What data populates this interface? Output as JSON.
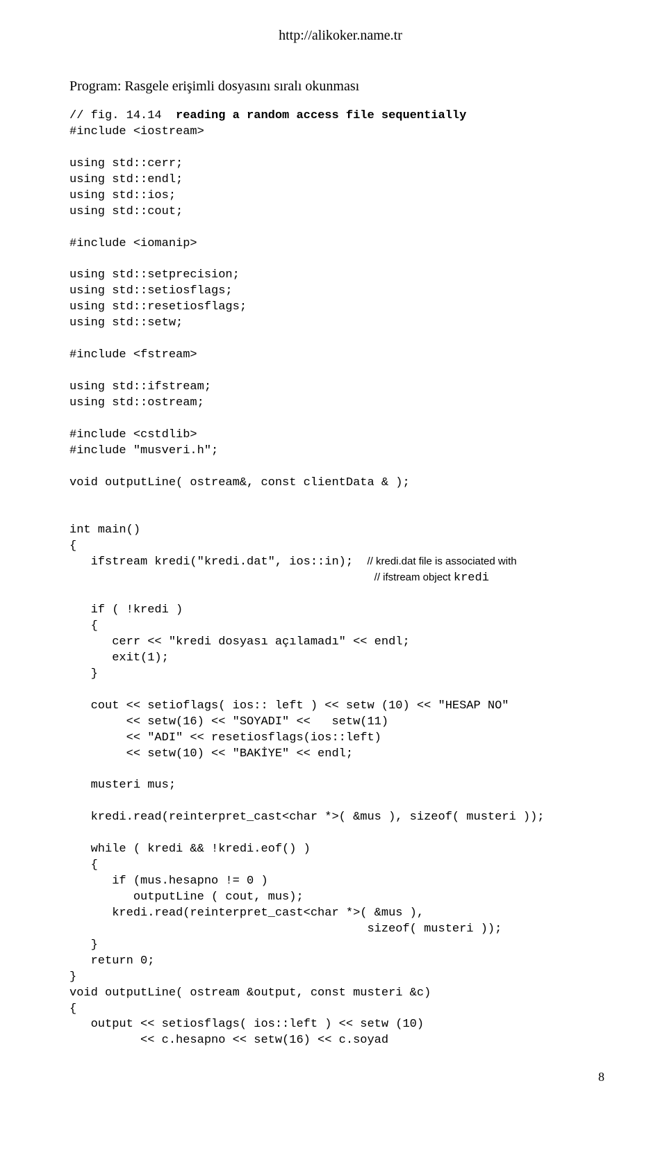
{
  "header_url": "http://alikoker.name.tr",
  "heading": "Program: Rasgele erişimli dosyasını  sıralı okunması",
  "code": {
    "l01a": "// fig. 14.14  ",
    "l01b": "reading a random access file sequentially",
    "l02": "#include <iostream>",
    "l03": "",
    "l04": "using std::cerr;",
    "l05": "using std::endl;",
    "l06": "using std::ios;",
    "l07": "using std::cout;",
    "l08": "",
    "l09": "#include <iomanip>",
    "l10": "",
    "l11": "using std::setprecision;",
    "l12": "using std::setiosflags;",
    "l13": "using std::resetiosflags;",
    "l14": "using std::setw;",
    "l15": "",
    "l16": "#include <fstream>",
    "l17": "",
    "l18": "using std::ifstream;",
    "l19": "using std::ostream;",
    "l20": "",
    "l21": "#include <cstdlib>",
    "l22": "#include \"musveri.h\";",
    "l23": "",
    "l24": "void outputLine( ostream&, const clientData & );",
    "l25": "",
    "l26": "",
    "l27": "int main()",
    "l28": "{",
    "l29a": "   ifstream kredi(\"kredi.dat\", ios::in);  ",
    "l29b": "// kredi.dat file is associated with",
    "l30a": "                                           ",
    "l30b": "// ifstream object ",
    "l30c": "kredi",
    "l31": "",
    "l32": "   if ( !kredi )",
    "l33": "   {",
    "l34": "      cerr << \"kredi dosyası açılamadı\" << endl;",
    "l35": "      exit(1);",
    "l36": "   }",
    "l37": "",
    "l38": "   cout << setioflags( ios:: left ) << setw (10) << \"HESAP NO\"",
    "l39": "        << setw(16) << \"SOYADI\" <<   setw(11)",
    "l40": "        << \"ADI\" << resetiosflags(ios::left)",
    "l41": "        << setw(10) << \"BAKİYE\" << endl;",
    "l42": "",
    "l43": "   musteri mus;",
    "l44": "",
    "l45": "   kredi.read(reinterpret_cast<char *>( &mus ), sizeof( musteri ));",
    "l46": "",
    "l47": "   while ( kredi && !kredi.eof() )",
    "l48": "   {",
    "l49": "      if (mus.hesapno != 0 )",
    "l50": "         outputLine ( cout, mus);",
    "l51": "      kredi.read(reinterpret_cast<char *>( &mus ),",
    "l52": "                                          sizeof( musteri ));",
    "l53": "   }",
    "l54": "   return 0;",
    "l55": "}",
    "l56": "void outputLine( ostream &output, const musteri &c)",
    "l57": "{",
    "l58": "   output << setiosflags( ios::left ) << setw (10)",
    "l59": "          << c.hesapno << setw(16) << c.soyad"
  },
  "page_number": "8"
}
